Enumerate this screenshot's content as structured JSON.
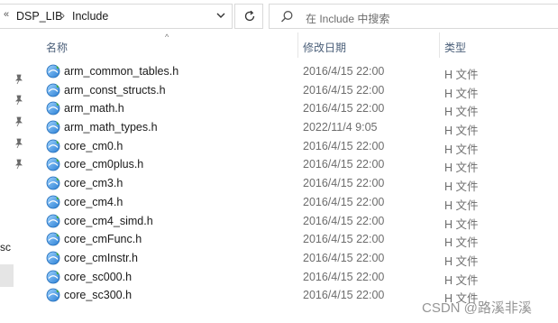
{
  "address_bar": {
    "crumbs": [
      "DSP_LIB",
      "Include"
    ]
  },
  "search": {
    "placeholder": "在 Include 中搜索"
  },
  "nav": {
    "partial_label": "sc"
  },
  "columns": {
    "name": "名称",
    "date": "修改日期",
    "type": "类型"
  },
  "files": [
    {
      "name": "arm_common_tables.h",
      "date": "2016/4/15 22:00",
      "type": "H 文件"
    },
    {
      "name": "arm_const_structs.h",
      "date": "2016/4/15 22:00",
      "type": "H 文件"
    },
    {
      "name": "arm_math.h",
      "date": "2016/4/15 22:00",
      "type": "H 文件"
    },
    {
      "name": "arm_math_types.h",
      "date": "2022/11/4 9:05",
      "type": "H 文件"
    },
    {
      "name": "core_cm0.h",
      "date": "2016/4/15 22:00",
      "type": "H 文件"
    },
    {
      "name": "core_cm0plus.h",
      "date": "2016/4/15 22:00",
      "type": "H 文件"
    },
    {
      "name": "core_cm3.h",
      "date": "2016/4/15 22:00",
      "type": "H 文件"
    },
    {
      "name": "core_cm4.h",
      "date": "2016/4/15 22:00",
      "type": "H 文件"
    },
    {
      "name": "core_cm4_simd.h",
      "date": "2016/4/15 22:00",
      "type": "H 文件"
    },
    {
      "name": "core_cmFunc.h",
      "date": "2016/4/15 22:00",
      "type": "H 文件"
    },
    {
      "name": "core_cmInstr.h",
      "date": "2016/4/15 22:00",
      "type": "H 文件"
    },
    {
      "name": "core_sc000.h",
      "date": "2016/4/15 22:00",
      "type": "H 文件"
    },
    {
      "name": "core_sc300.h",
      "date": "2016/4/15 22:00",
      "type": "H 文件"
    }
  ],
  "watermark": "CSDN @路溪非溪",
  "colors": {
    "header_text": "#4c607a",
    "secondary_text": "#6d6d6d",
    "border": "#d9d9d9",
    "selection": "#e5e5e5"
  }
}
